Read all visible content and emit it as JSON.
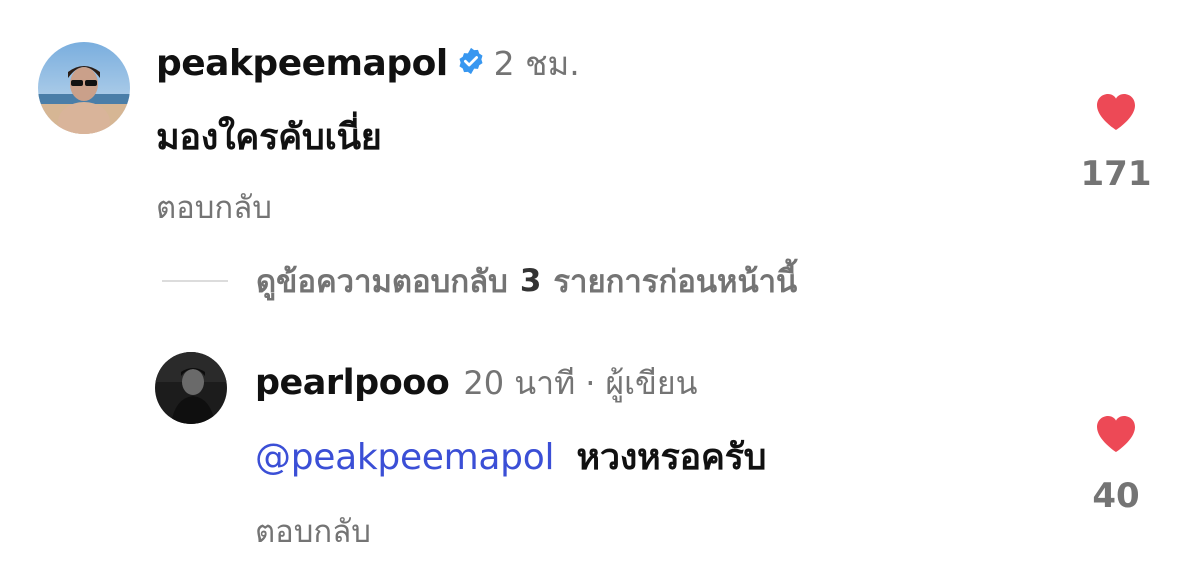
{
  "comments": [
    {
      "username": "peakpeemapol",
      "verified": true,
      "time": "2 ชม.",
      "text": "มองใครคับเนี่ย",
      "reply_label": "ตอบกลับ",
      "likes": "171"
    },
    {
      "username": "pearlpooo",
      "time": "20 นาที",
      "separator": "·",
      "author_label": "ผู้เขียน",
      "mention": "@peakpeemapol",
      "text": "หวงหรอครับ",
      "reply_label": "ตอบกลับ",
      "likes": "40"
    }
  ],
  "view_replies": {
    "prefix": "ดูข้อความตอบกลับ",
    "count": "3",
    "suffix": "รายการก่อนหน้านี้"
  },
  "colors": {
    "like_red": "#ed4956",
    "verified_blue": "#3897f0",
    "mention_blue": "#3b4fd6",
    "meta_gray": "#747474"
  }
}
